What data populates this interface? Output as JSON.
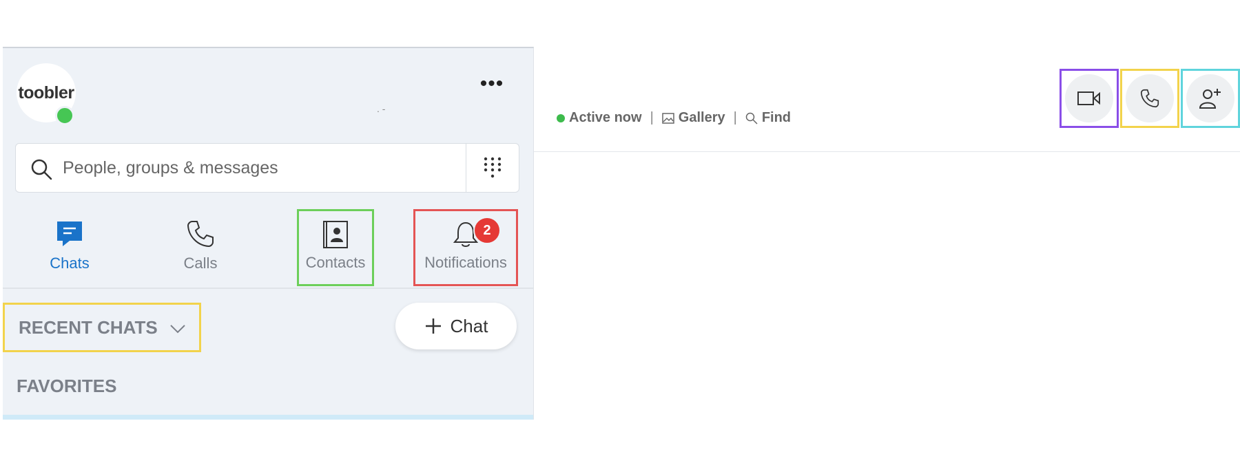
{
  "sidebar": {
    "profile": {
      "logo_text": "toobler",
      "name_placeholder": ". -"
    },
    "more_button": "•••",
    "search": {
      "placeholder": "People, groups & messages"
    },
    "tabs": [
      {
        "label": "Chats"
      },
      {
        "label": "Calls"
      },
      {
        "label": "Contacts"
      },
      {
        "label": "Notifications",
        "badge": "2"
      }
    ],
    "recent_chats_label": "RECENT CHATS",
    "new_chat_label": "Chat",
    "favorites_label": "FAVORITES"
  },
  "header": {
    "status": "Active now",
    "separator": "|",
    "gallery_label": "Gallery",
    "find_label": "Find"
  },
  "colors": {
    "accent": "#1a73c9",
    "online": "#46c654",
    "badge": "#e53935",
    "highlight_contacts": "#6ccf5a",
    "highlight_notifications": "#e45454",
    "highlight_recent_chats": "#f2d34b",
    "highlight_video": "#8a4ee8",
    "highlight_audio": "#f2d34b",
    "highlight_add_people": "#5fd4dc"
  },
  "icons": [
    "search-icon",
    "dialpad-icon",
    "chat-icon",
    "phone-icon",
    "contacts-icon",
    "bell-icon",
    "chevron-down-icon",
    "plus-icon",
    "gallery-icon",
    "video-call-icon",
    "audio-call-icon",
    "add-person-icon"
  ]
}
